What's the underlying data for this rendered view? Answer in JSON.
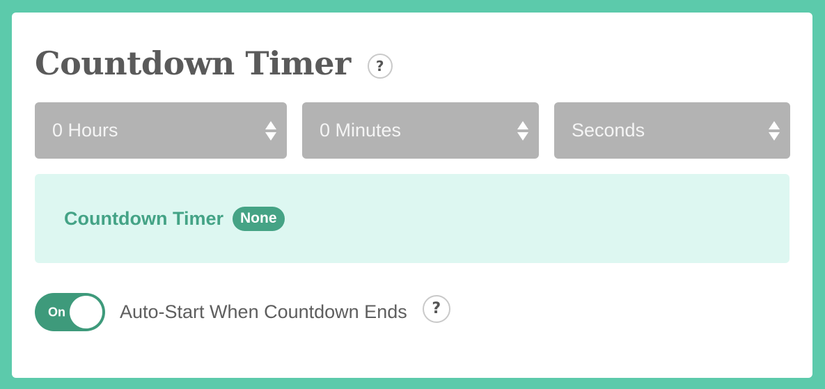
{
  "title": "Countdown Timer",
  "title_help": "?",
  "selects": {
    "hours": "0 Hours",
    "minutes": "0 Minutes",
    "seconds": "Seconds"
  },
  "status": {
    "label": "Countdown Timer",
    "badge": "None"
  },
  "auto_start": {
    "toggle_label": "On",
    "label": "Auto-Start When Countdown Ends",
    "help": "?"
  },
  "colors": {
    "background": "#5ccaab",
    "select_bg": "#b3b3b3",
    "status_bg": "#ddf7f1",
    "accent": "#45a385",
    "toggle_on": "#3e9a7b"
  },
  "icons": {
    "help": "question-mark-circle-icon",
    "select_arrows": "up-down-arrows-icon"
  }
}
